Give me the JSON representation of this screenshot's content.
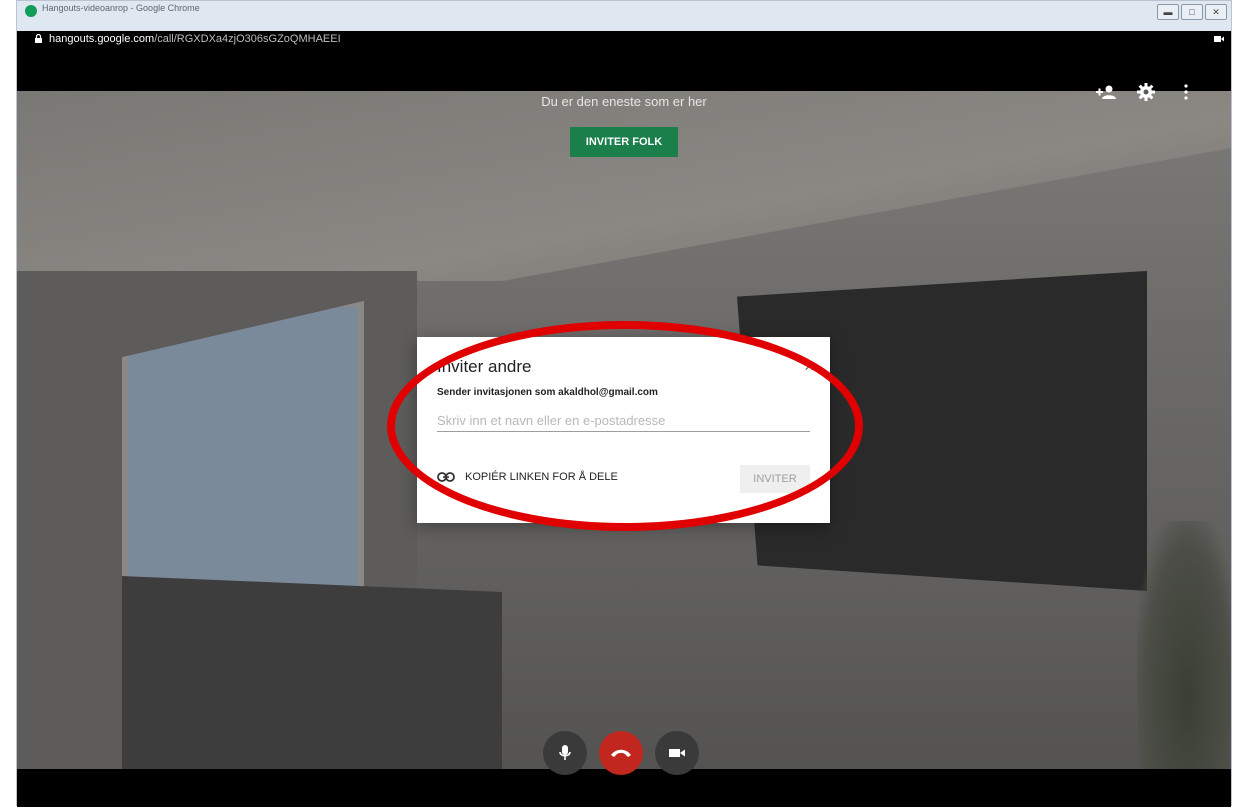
{
  "window": {
    "title": "Hangouts-videoanrop - Google Chrome",
    "url_host": "hangouts.google.com",
    "url_path": "/call/RGXDXa4zjO306sGZoQMHAEEI",
    "controls": [
      "minimize",
      "maximize",
      "close"
    ]
  },
  "call": {
    "status_text": "Du er den eneste som er her",
    "invite_people_label": "INVITER FOLK",
    "top_icons": [
      "add-person-icon",
      "gear-icon",
      "more-vert-icon"
    ]
  },
  "dialog": {
    "title": "Inviter andre",
    "sender_text": "Sender invitasjonen som akaldhol@gmail.com",
    "input_placeholder": "Skriv inn et navn eller en e-postadresse",
    "copy_link_label": "KOPIÉR LINKEN FOR Å DELE",
    "invite_button_label": "INVITER",
    "close_symbol": "×"
  },
  "controls": {
    "buttons": [
      "microphone-icon",
      "end-call-icon",
      "camera-icon"
    ]
  },
  "colors": {
    "accent_green": "#1a7f4b",
    "end_call_red": "#c1271e",
    "highlight_red": "#e00000"
  }
}
